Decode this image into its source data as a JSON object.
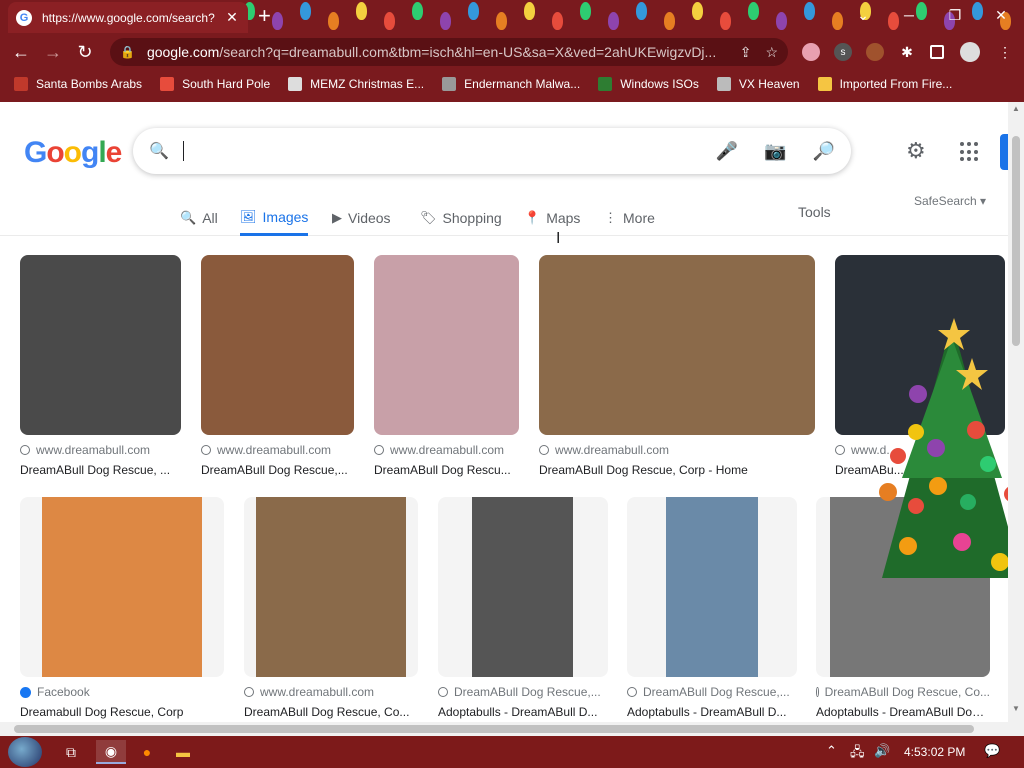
{
  "browser": {
    "tab_title": "https://www.google.com/search?",
    "tab_close": "✕",
    "new_tab": "+",
    "url_host": "google.com",
    "url_rest": "/search?q=dreamabull.com&tbm=isch&hl=en-US&sa=X&ved=2ahUKEwigzvDj...",
    "window_controls": [
      "⌄",
      "─",
      "❐",
      "✕"
    ]
  },
  "bookmarks": [
    {
      "label": "Santa Bombs Arabs",
      "color": "#c0392b"
    },
    {
      "label": "South Hard Pole",
      "color": "#e74c3c"
    },
    {
      "label": "MEMZ Christmas E...",
      "color": "#dddddd"
    },
    {
      "label": "Endermanch Malwa...",
      "color": "#999999"
    },
    {
      "label": "Windows ISOs",
      "color": "#2e7d32"
    },
    {
      "label": "VX Heaven",
      "color": "#bbbbbb"
    },
    {
      "label": "Imported From Fire...",
      "color": "#f5c542"
    }
  ],
  "google": {
    "logo_letters": [
      {
        "ch": "G",
        "color": "#4285f4"
      },
      {
        "ch": "o",
        "color": "#ea4335"
      },
      {
        "ch": "o",
        "color": "#fbbc05"
      },
      {
        "ch": "g",
        "color": "#4285f4"
      },
      {
        "ch": "l",
        "color": "#34a853"
      },
      {
        "ch": "e",
        "color": "#ea4335"
      }
    ],
    "search_value": "",
    "tabs": [
      {
        "label": "All",
        "icon": "🔍"
      },
      {
        "label": "Images",
        "icon": "🖼"
      },
      {
        "label": "Videos",
        "icon": "▶"
      },
      {
        "label": "Shopping",
        "icon": "🏷"
      },
      {
        "label": "Maps",
        "icon": "📍"
      },
      {
        "label": "More",
        "icon": "⋮"
      }
    ],
    "tools": "Tools",
    "safesearch": "SafeSearch ▾"
  },
  "results_row1": [
    {
      "source": "www.dreamabull.com",
      "title": "DreamABull Dog Rescue, ...",
      "color": "#4a4a4a",
      "source_icon": "globe"
    },
    {
      "source": "www.dreamabull.com",
      "title": "DreamABull Dog Rescue,...",
      "color": "#8a5a3c",
      "source_icon": "globe"
    },
    {
      "source": "www.dreamabull.com",
      "title": "DreamABull Dog Rescu...",
      "color": "#c8a0a8",
      "source_icon": "globe"
    },
    {
      "source": "www.dreamabull.com",
      "title": "DreamABull Dog Rescue, Corp - Home",
      "color": "#8b6a4a",
      "source_icon": "globe"
    },
    {
      "source": "www.d...",
      "title": "DreamABu...",
      "color": "#2a3038",
      "source_icon": "globe"
    }
  ],
  "results_row2": [
    {
      "source": "Facebook",
      "title": "Dreamabull Dog Rescue, Corp",
      "color": "#d84",
      "source_icon": "fb"
    },
    {
      "source": "www.dreamabull.com",
      "title": "DreamABull Dog Rescue, Co...",
      "color": "#8a6a4a",
      "source_icon": "globe"
    },
    {
      "source": "DreamABull Dog Rescue,...",
      "title": "Adoptabulls - DreamABull D...",
      "color": "#555",
      "source_icon": "globe"
    },
    {
      "source": "DreamABull Dog Rescue,...",
      "title": "Adoptabulls - DreamABull D...",
      "color": "#6a8aa8",
      "source_icon": "globe"
    },
    {
      "source": "DreamABull Dog Rescue, Co...",
      "title": "Adoptabulls - DreamABull Dog ...",
      "color": "#777",
      "source_icon": "globe"
    }
  ],
  "taskbar": {
    "clock": "4:53:02 PM"
  }
}
